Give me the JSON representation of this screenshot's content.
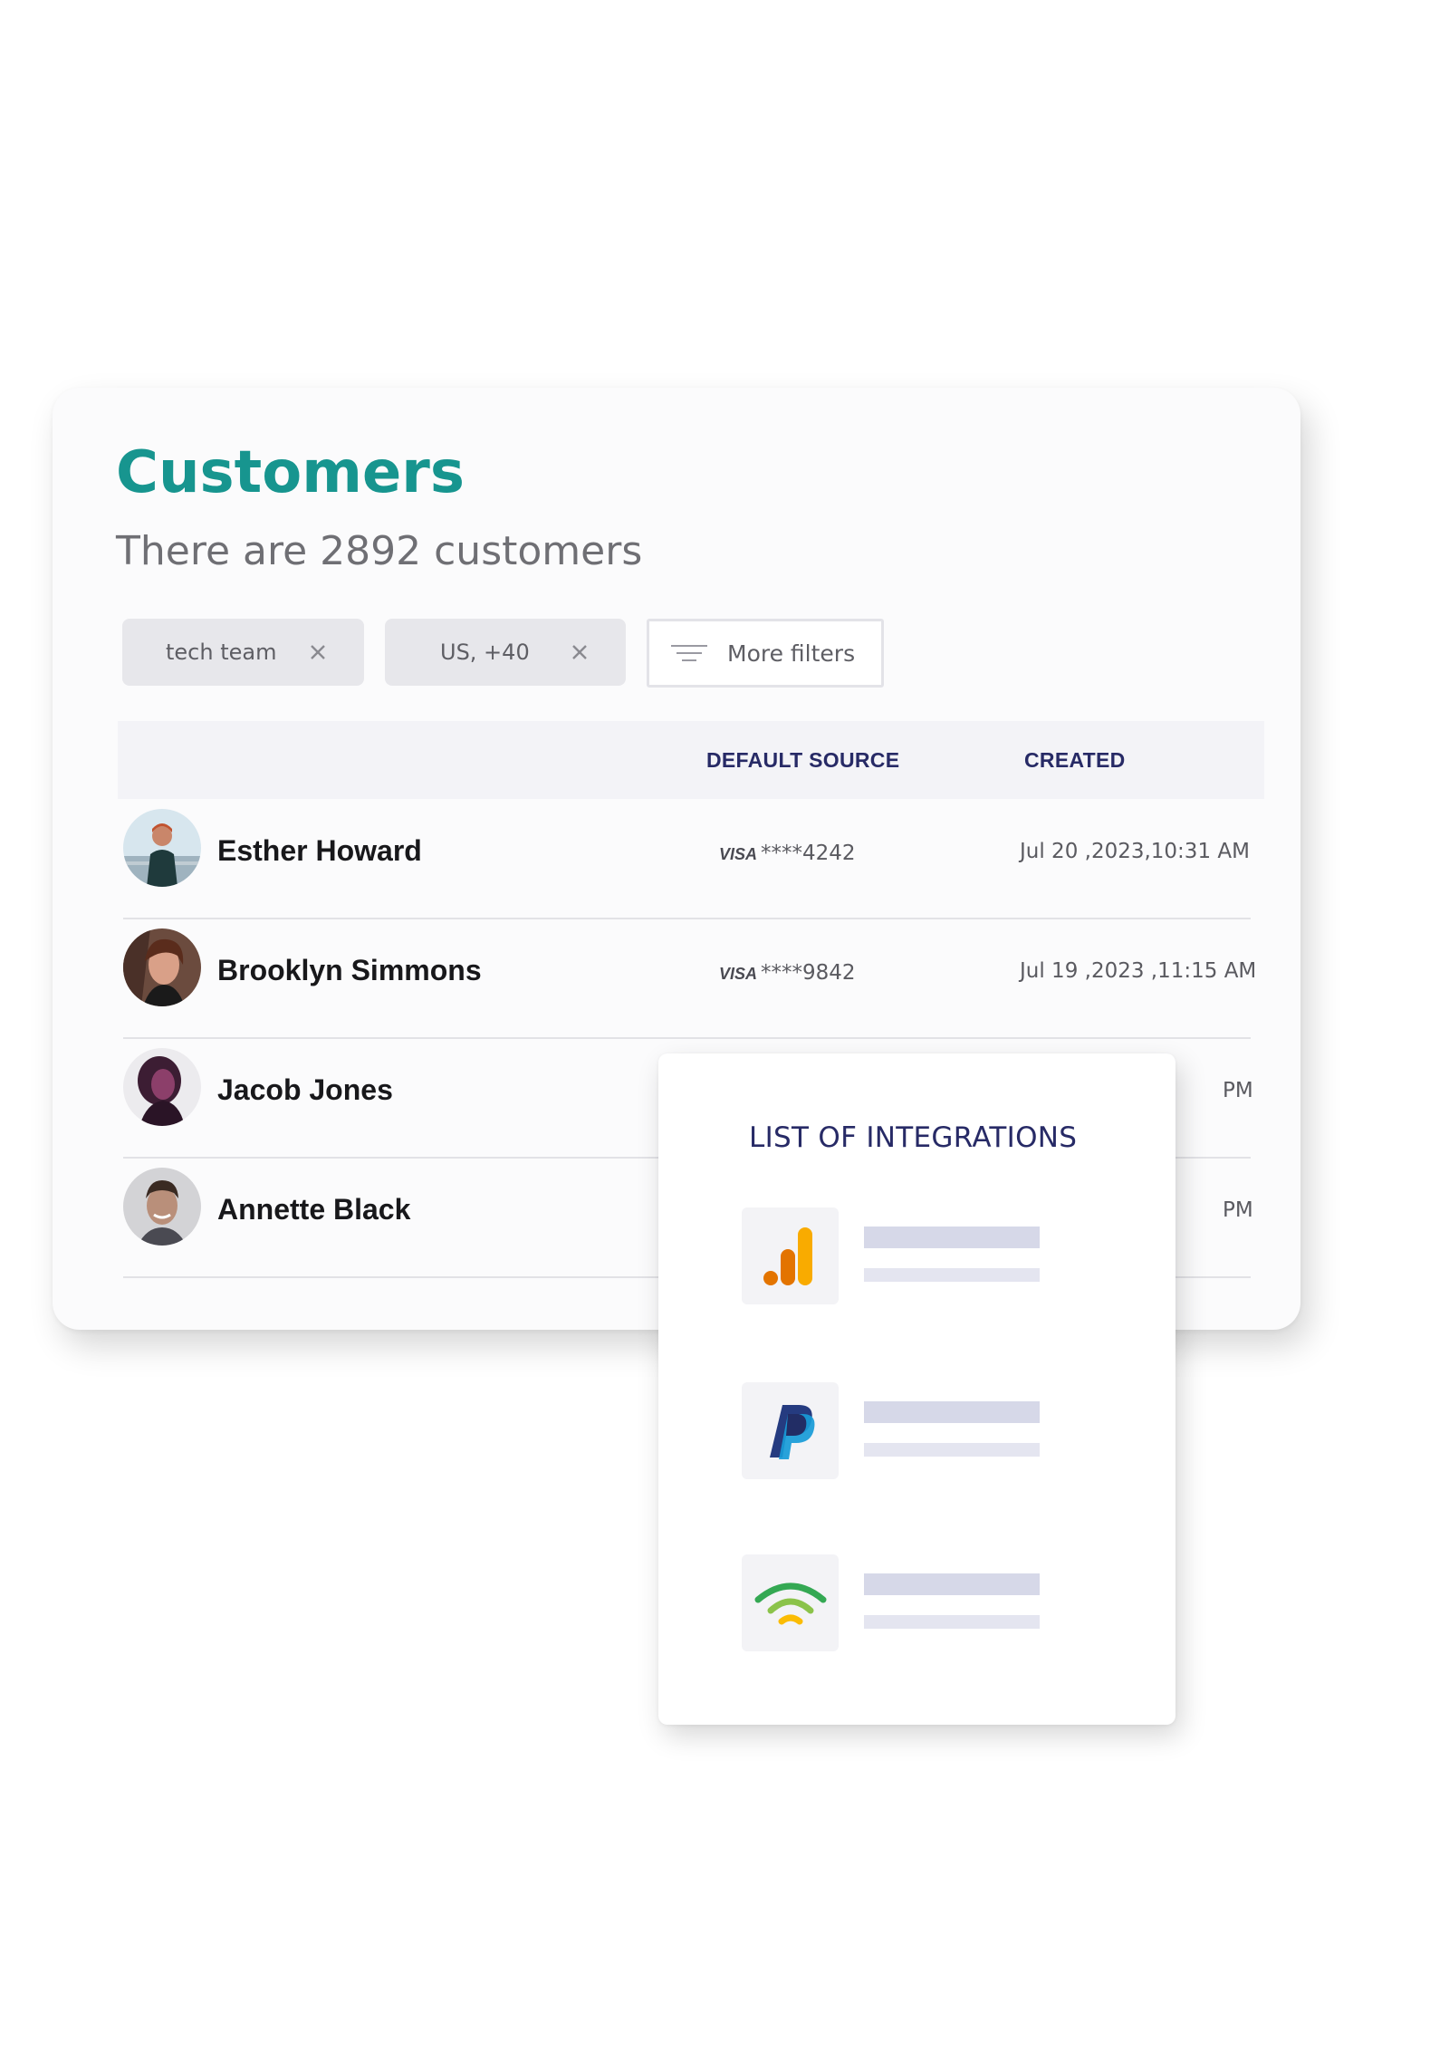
{
  "customers": {
    "title": "Customers",
    "subtitle": "There are 2892 customers",
    "filters": [
      {
        "label": "tech team",
        "close_icon": "close-icon"
      },
      {
        "label": "US, +40",
        "close_icon": "close-icon"
      }
    ],
    "more_filters": {
      "label": "More filters",
      "icon": "filter-lines-icon"
    },
    "columns": {
      "default_source": "DEFAULT SOURCE",
      "created": "CREATED"
    },
    "rows": [
      {
        "name": "Esther Howard",
        "card_brand": "VISA",
        "card": "****4242",
        "created": "Jul  20 ,2023,10:31 AM"
      },
      {
        "name": "Brooklyn Simmons",
        "card_brand": "VISA",
        "card": "****9842",
        "created": "Jul 19 ,2023 ,11:15 AM"
      },
      {
        "name": "Jacob Jones",
        "card_brand": "",
        "card": "",
        "created": "PM"
      },
      {
        "name": "Annette Black",
        "card_brand": "",
        "card": "",
        "created": "PM"
      }
    ]
  },
  "integrations": {
    "title": "LIST OF INTEGRATIONS",
    "items": [
      {
        "icon": "google-analytics-icon",
        "colors": [
          "#f9ab00",
          "#e37400"
        ]
      },
      {
        "icon": "paypal-icon",
        "colors": [
          "#253b80",
          "#179bd7"
        ]
      },
      {
        "icon": "wifi-signal-icon",
        "colors": [
          "#34a853",
          "#8bc34a",
          "#fbbc04"
        ]
      }
    ]
  },
  "colors": {
    "brand_teal": "#17958f",
    "heading_navy": "#272a66",
    "chip_bg": "#e7e7eb"
  }
}
